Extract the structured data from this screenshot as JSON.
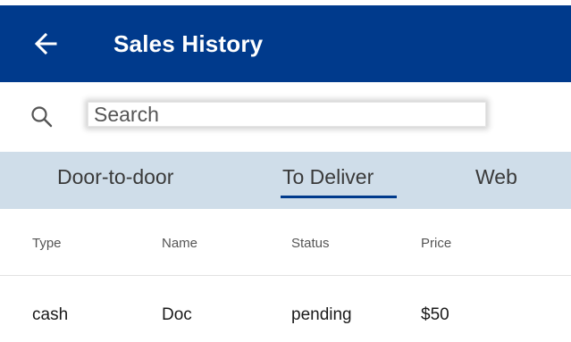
{
  "header": {
    "title": "Sales History",
    "back_icon": "arrow-left-icon",
    "background": "#003a8c"
  },
  "search": {
    "placeholder": "Search",
    "value": "",
    "icon": "search-icon"
  },
  "tabs": [
    {
      "label": "Door-to-door",
      "selected": false
    },
    {
      "label": "To Deliver",
      "selected": true
    },
    {
      "label": "Web",
      "selected": false
    }
  ],
  "table": {
    "columns": [
      "Type",
      "Name",
      "Status",
      "Price"
    ],
    "rows": [
      [
        "cash",
        "Doc",
        "pending",
        "$50"
      ]
    ]
  },
  "colors": {
    "accent": "#003a8c",
    "tab_bar": "#cfdde9"
  }
}
